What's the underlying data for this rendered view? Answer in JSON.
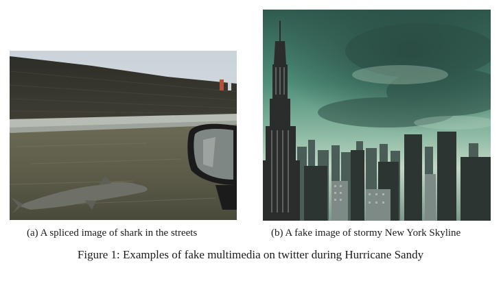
{
  "figure": {
    "caption": "Figure 1: Examples of fake multimedia on twitter during Hurricane Sandy",
    "subfigures": [
      {
        "caption": "(a) A spliced image of shark in the streets",
        "image_icon": "flooded-street-shark-photo"
      },
      {
        "caption": "(b) A fake image of stormy New York Skyline",
        "image_icon": "stormy-new-york-skyline-photo"
      }
    ]
  }
}
